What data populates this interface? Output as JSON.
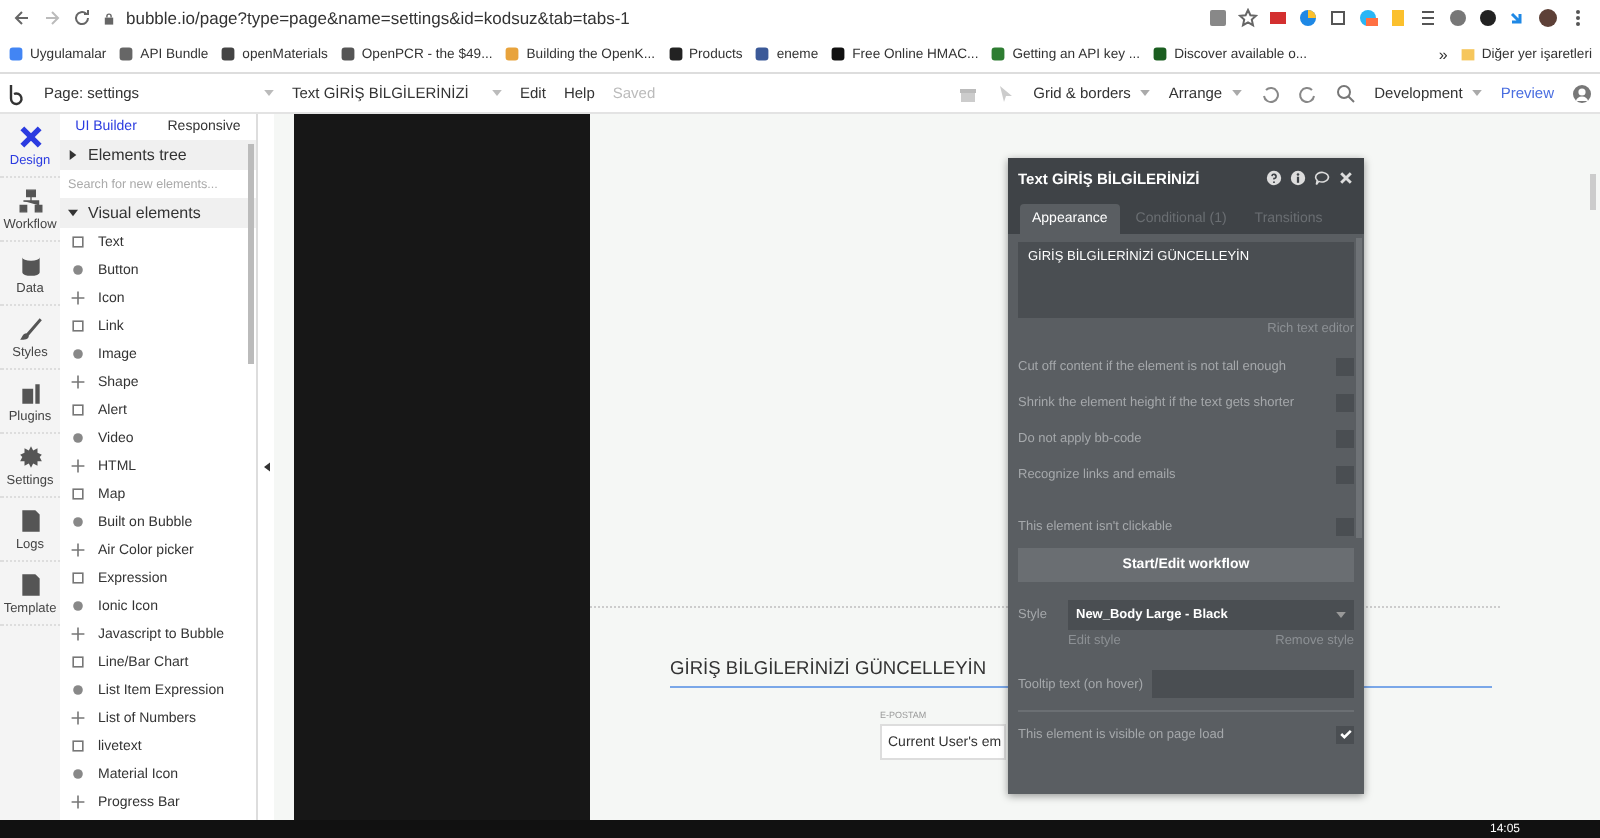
{
  "browser": {
    "url": "bubble.io/page?type=page&name=settings&id=kodsuz&tab=tabs-1",
    "bookmarks": [
      "Uygulamalar",
      "API Bundle",
      "openMaterials",
      "OpenPCR - the $49...",
      "Building the OpenK...",
      "Products",
      "eneme",
      "Free Online HMAC...",
      "Getting an API key ...",
      "Discover available o..."
    ],
    "more": "»",
    "other_bookmarks": "Diğer yer işaretleri"
  },
  "toolbar": {
    "page": "Page: settings",
    "element": "Text GİRİŞ BİLGİLERİNİZİ",
    "menus": [
      "Edit",
      "Help"
    ],
    "saved": "Saved",
    "right": [
      "Grid & borders",
      "Arrange"
    ],
    "mode": "Development",
    "preview": "Preview"
  },
  "nav": [
    {
      "label": "Design",
      "selected": true
    },
    {
      "label": "Workflow",
      "selected": false
    },
    {
      "label": "Data",
      "selected": false
    },
    {
      "label": "Styles",
      "selected": false
    },
    {
      "label": "Plugins",
      "selected": false
    },
    {
      "label": "Settings",
      "selected": false
    },
    {
      "label": "Logs",
      "selected": false
    },
    {
      "label": "Template",
      "selected": false
    }
  ],
  "panel": {
    "tabs": [
      {
        "label": "UI Builder",
        "selected": true
      },
      {
        "label": "Responsive",
        "selected": false
      }
    ],
    "tree": "Elements tree",
    "search_placeholder": "Search for new elements...",
    "section": "Visual elements",
    "elements": [
      "Text",
      "Button",
      "Icon",
      "Link",
      "Image",
      "Shape",
      "Alert",
      "Video",
      "HTML",
      "Map",
      "Built on Bubble",
      "Air Color picker",
      "Expression",
      "Ionic Icon",
      "Javascript to Bubble",
      "Line/Bar Chart",
      "List Item Expression",
      "List of Numbers",
      "livetext",
      "Material Icon",
      "Progress Bar"
    ]
  },
  "editor": {
    "title": "Text GİRİŞ BİLGİLERİNİZİ",
    "tabs": [
      {
        "label": "Appearance",
        "selected": true
      },
      {
        "label": "Conditional (1)",
        "selected": false
      },
      {
        "label": "Transitions",
        "selected": false
      }
    ],
    "content": "GİRİŞ BİLGİLERİNİZİ GÜNCELLEYİN",
    "rich_link": "Rich text editor",
    "options": [
      {
        "label": "Cut off content if the element is not tall enough",
        "checked": false
      },
      {
        "label": "Shrink the element height if the text gets shorter",
        "checked": false
      },
      {
        "label": "Do not apply bb-code",
        "checked": false
      },
      {
        "label": "Recognize links and emails",
        "checked": false
      }
    ],
    "not_clickable": {
      "label": "This element isn't clickable",
      "checked": false
    },
    "workflow_button": "Start/Edit workflow",
    "style_label": "Style",
    "style_value": "New_Body Large - Black",
    "edit_style": "Edit style",
    "remove_style": "Remove style",
    "tooltip_label": "Tooltip text (on hover)",
    "visible": {
      "label": "This element is visible on page load",
      "checked": true
    }
  },
  "canvas": {
    "heading": "GİRİŞ BİLGİLERİNİZİ GÜNCELLEYİN",
    "field_label": "E-POSTAM",
    "field_value": "Current User's em"
  },
  "taskbar": {
    "clock": "14:05"
  }
}
